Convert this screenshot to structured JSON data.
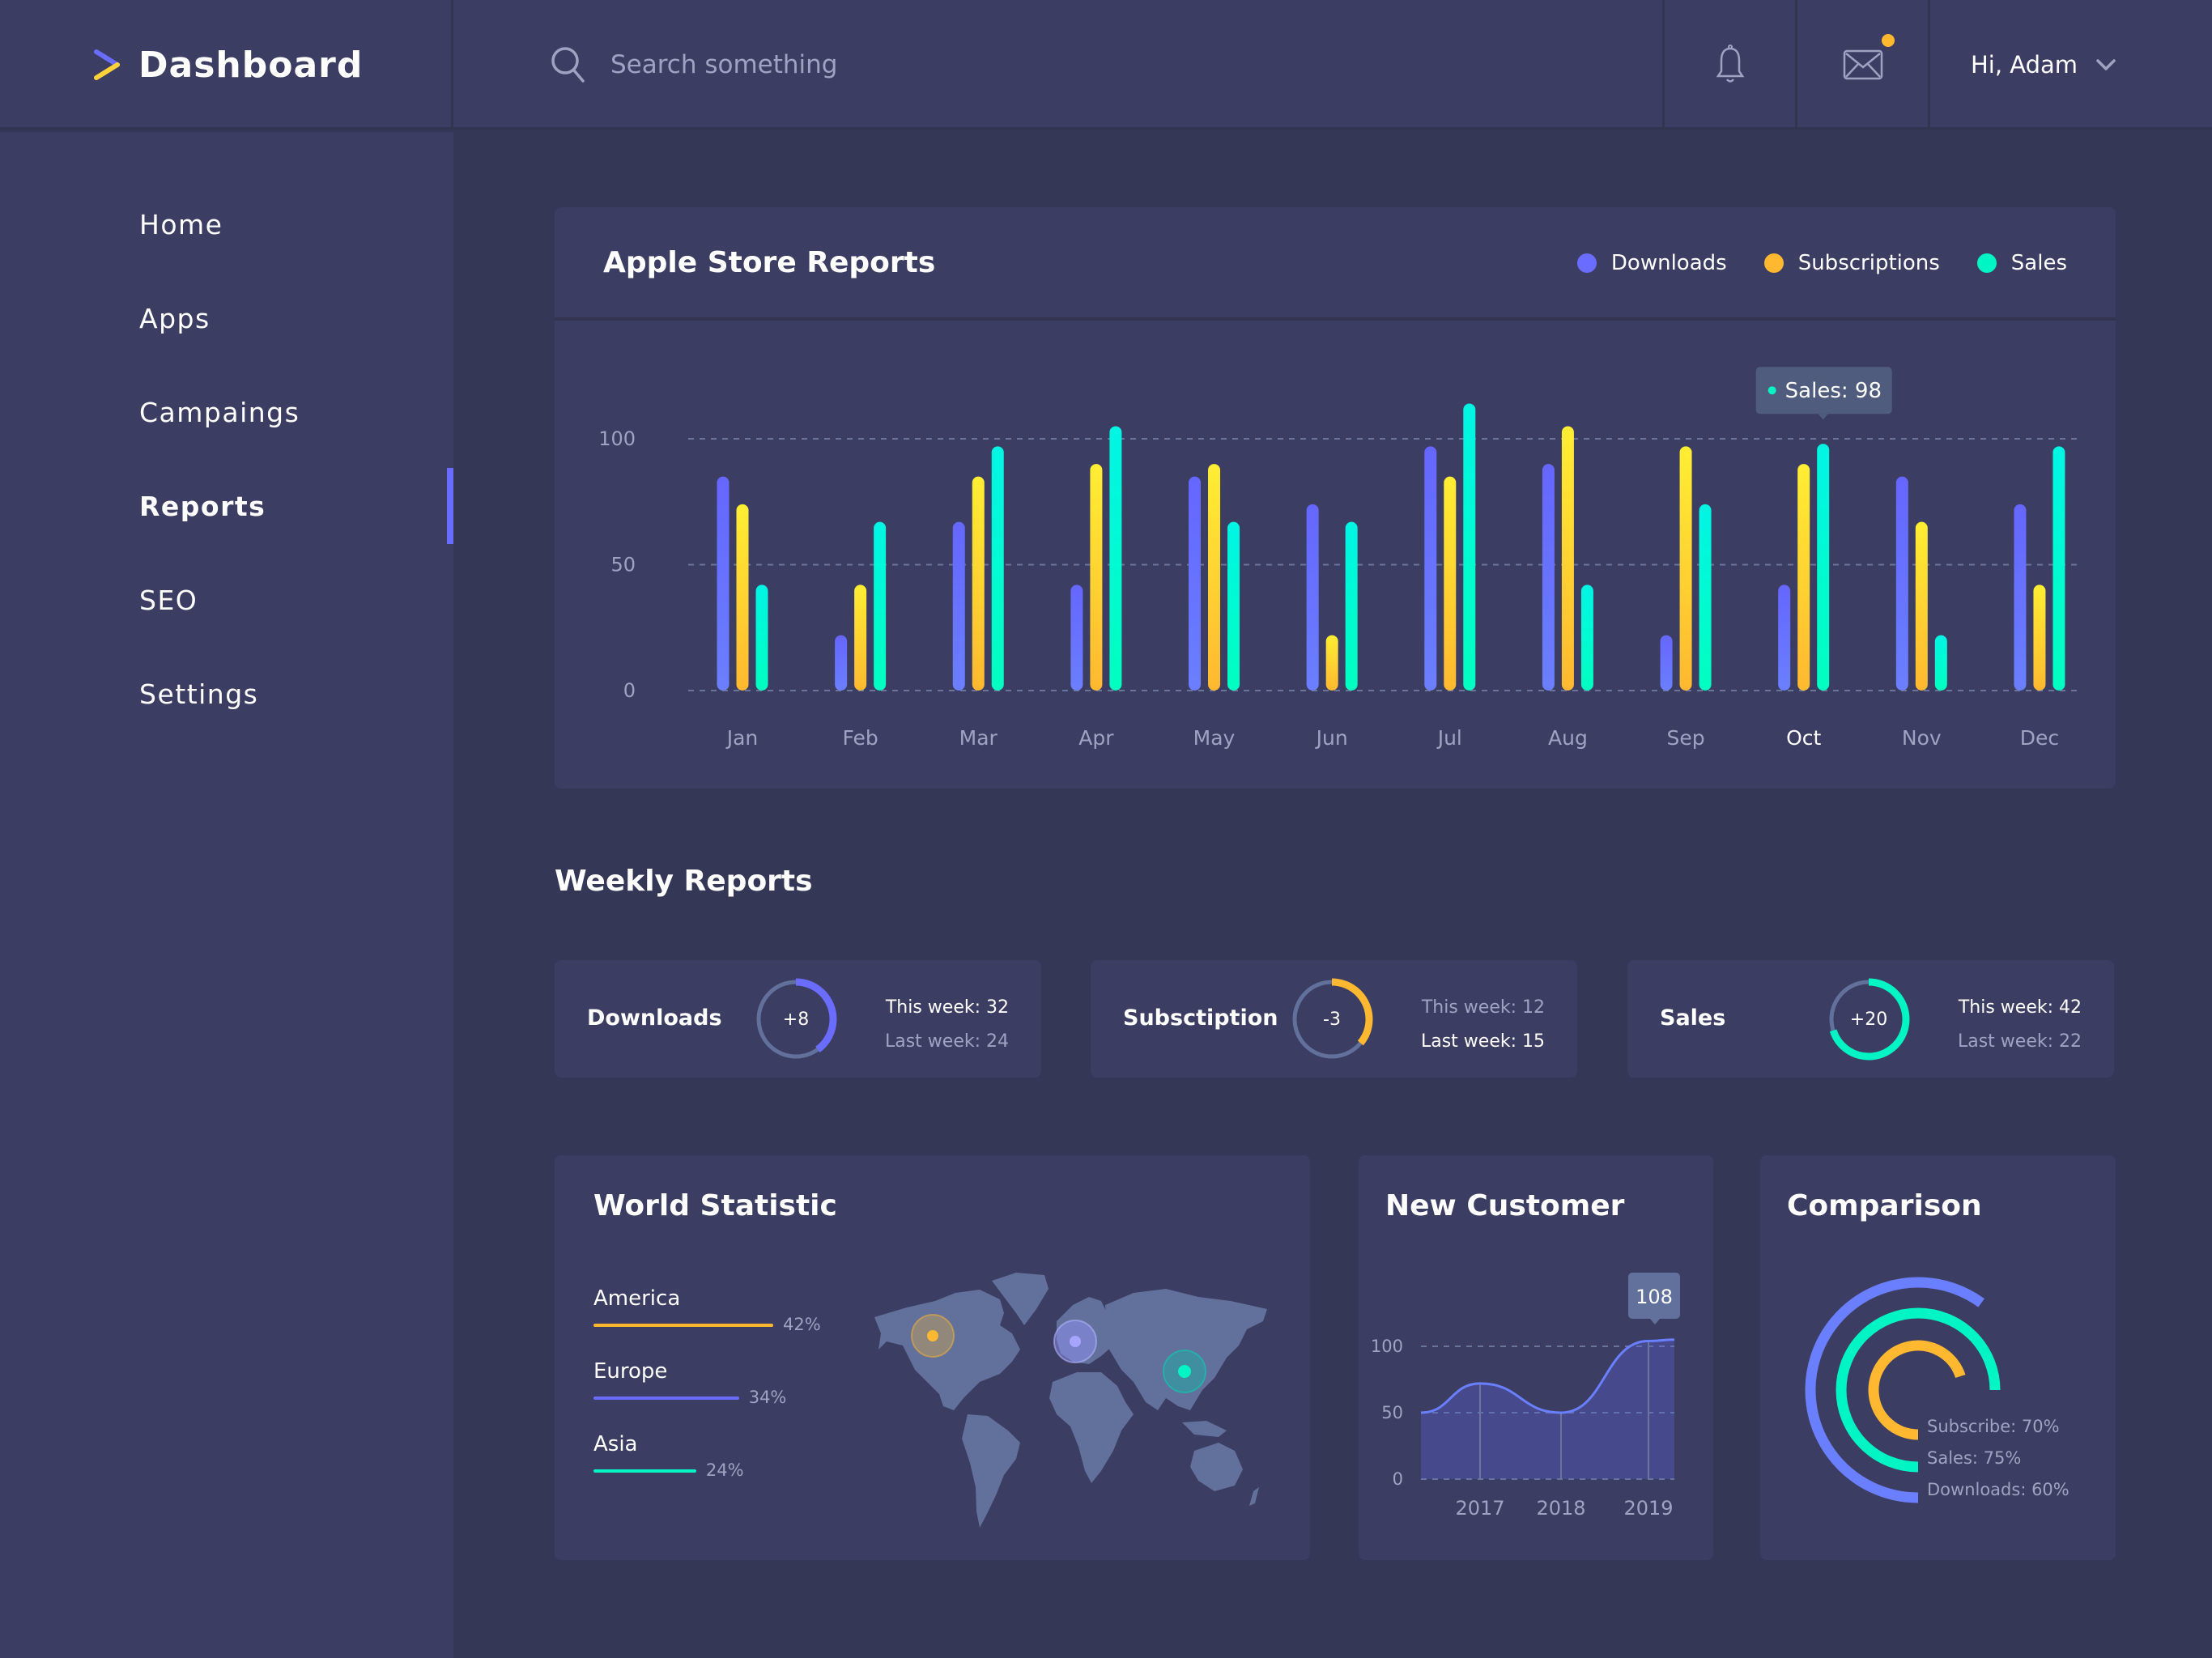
{
  "app": {
    "title": "Dashboard",
    "search_placeholder": "Search something",
    "greeting": "Hi, Adam",
    "icons": {
      "logo": "play-logo-icon",
      "search": "search-icon",
      "bell": "bell-icon",
      "mail": "mail-icon",
      "dropdown": "chevron-down-icon"
    },
    "mail_badge_color": "#ffb830"
  },
  "sidebar": {
    "items": [
      {
        "label": "Home",
        "active": false
      },
      {
        "label": "Apps",
        "active": false
      },
      {
        "label": "Campaings",
        "active": false
      },
      {
        "label": "Reports",
        "active": true
      },
      {
        "label": "SEO",
        "active": false
      },
      {
        "label": "Settings",
        "active": false
      }
    ],
    "accent": "#6a6cff"
  },
  "colors": {
    "downloads": "#6a6cff",
    "subscriptions": "#ffb830",
    "sales": "#00f5c4",
    "grid": "#6a7599",
    "muted_text": "#9fa3c2"
  },
  "apple_store": {
    "title": "Apple Store Reports",
    "legend": [
      "Downloads",
      "Subscriptions",
      "Sales"
    ],
    "tooltip": {
      "label": "Sales: 98",
      "month": "Oct"
    },
    "highlight_month": "Oct"
  },
  "weekly": {
    "title": "Weekly Reports",
    "cards": [
      {
        "label": "Downloads",
        "delta": "+8",
        "this_week": "This week: 32",
        "last_week": "Last week: 24",
        "fraction": 0.4,
        "color": "#6a6cff",
        "emphasis": "this"
      },
      {
        "label": "Subsctiption",
        "delta": "-3",
        "this_week": "This week: 12",
        "last_week": "Last week: 15",
        "fraction": 0.36,
        "color": "#ffb830",
        "emphasis": "last"
      },
      {
        "label": "Sales",
        "delta": "+20",
        "this_week": "This week: 42",
        "last_week": "Last week: 22",
        "fraction": 0.7,
        "color": "#00f5c4",
        "emphasis": "this"
      }
    ]
  },
  "world": {
    "title": "World Statistic",
    "regions": [
      {
        "name": "America",
        "percent": 42,
        "label": "42%",
        "color": "#ffb830"
      },
      {
        "name": "Europe",
        "percent": 34,
        "label": "34%",
        "color": "#6a6cff"
      },
      {
        "name": "Asia",
        "percent": 24,
        "label": "24%",
        "color": "#00f5c4"
      }
    ]
  },
  "new_customer": {
    "title": "New Customer",
    "tooltip": "108"
  },
  "comparison": {
    "title": "Comparison",
    "items": [
      {
        "label": "Subscribe: 70%",
        "percent": 70,
        "color": "#ffb830"
      },
      {
        "label": "Sales: 75%",
        "percent": 75,
        "color": "#00f5c4"
      },
      {
        "label": "Downloads: 60%",
        "percent": 60,
        "color": "#6a7fff"
      }
    ]
  },
  "chart_data": [
    {
      "type": "bar",
      "title": "Apple Store Reports",
      "categories": [
        "Jan",
        "Feb",
        "Mar",
        "Apr",
        "May",
        "Jun",
        "Jul",
        "Aug",
        "Sep",
        "Oct",
        "Nov",
        "Dec"
      ],
      "series": [
        {
          "name": "Downloads",
          "values": [
            85,
            22,
            67,
            42,
            85,
            74,
            97,
            90,
            22,
            42,
            85,
            74
          ]
        },
        {
          "name": "Subscriptions",
          "values": [
            74,
            42,
            85,
            90,
            90,
            22,
            85,
            105,
            97,
            90,
            67,
            42
          ]
        },
        {
          "name": "Sales",
          "values": [
            42,
            67,
            97,
            105,
            67,
            67,
            114,
            42,
            74,
            98,
            22,
            97
          ]
        }
      ],
      "yticks": [
        0,
        50,
        100
      ],
      "ylim": [
        0,
        120
      ],
      "grid": true,
      "legend": "top-right",
      "xlabel": "",
      "ylabel": ""
    },
    {
      "type": "area",
      "title": "New Customer",
      "x": [
        "2016.3",
        "2017",
        "2018",
        "2019",
        "2019.3"
      ],
      "xticks": [
        "2017",
        "2018",
        "2019"
      ],
      "values": [
        50,
        72,
        50,
        104,
        105
      ],
      "yticks": [
        0,
        50,
        100
      ],
      "ylim": [
        0,
        110
      ],
      "annotation": "108",
      "grid": true
    },
    {
      "type": "pie",
      "title": "Comparison",
      "categories": [
        "Subscribe",
        "Sales",
        "Downloads"
      ],
      "values": [
        70,
        75,
        60
      ]
    }
  ]
}
